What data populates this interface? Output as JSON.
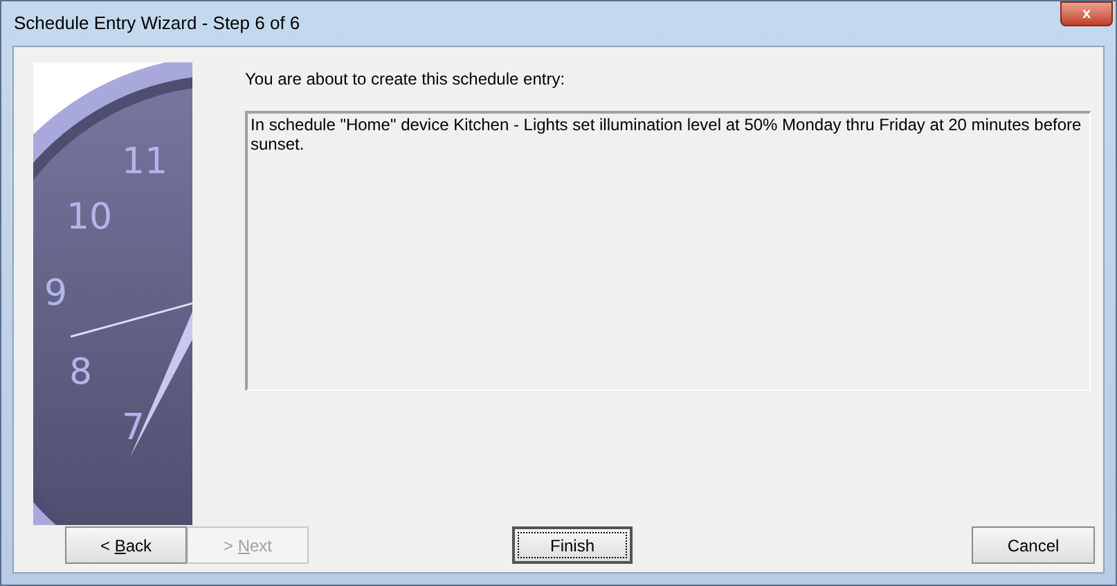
{
  "window": {
    "title": "Schedule Entry Wizard - Step 6 of 6",
    "close_label": "x"
  },
  "clock": {
    "numerals": [
      "11",
      "10",
      "9",
      "8",
      "7"
    ]
  },
  "prompt": "You are about to create this schedule entry:",
  "summary": "In schedule \"Home\" device Kitchen - Lights set illumination level at 50% Monday thru Friday at 20 minutes before sunset.",
  "buttons": [
    {
      "prefix": "< ",
      "key": "B",
      "rest": "ack",
      "disabled": false,
      "default": false
    },
    {
      "prefix": "> ",
      "key": "N",
      "rest": "ext",
      "disabled": true,
      "default": false
    },
    {
      "rest": "Finish",
      "disabled": false,
      "default": true
    },
    {
      "rest": "Cancel",
      "disabled": false,
      "default": false
    }
  ]
}
